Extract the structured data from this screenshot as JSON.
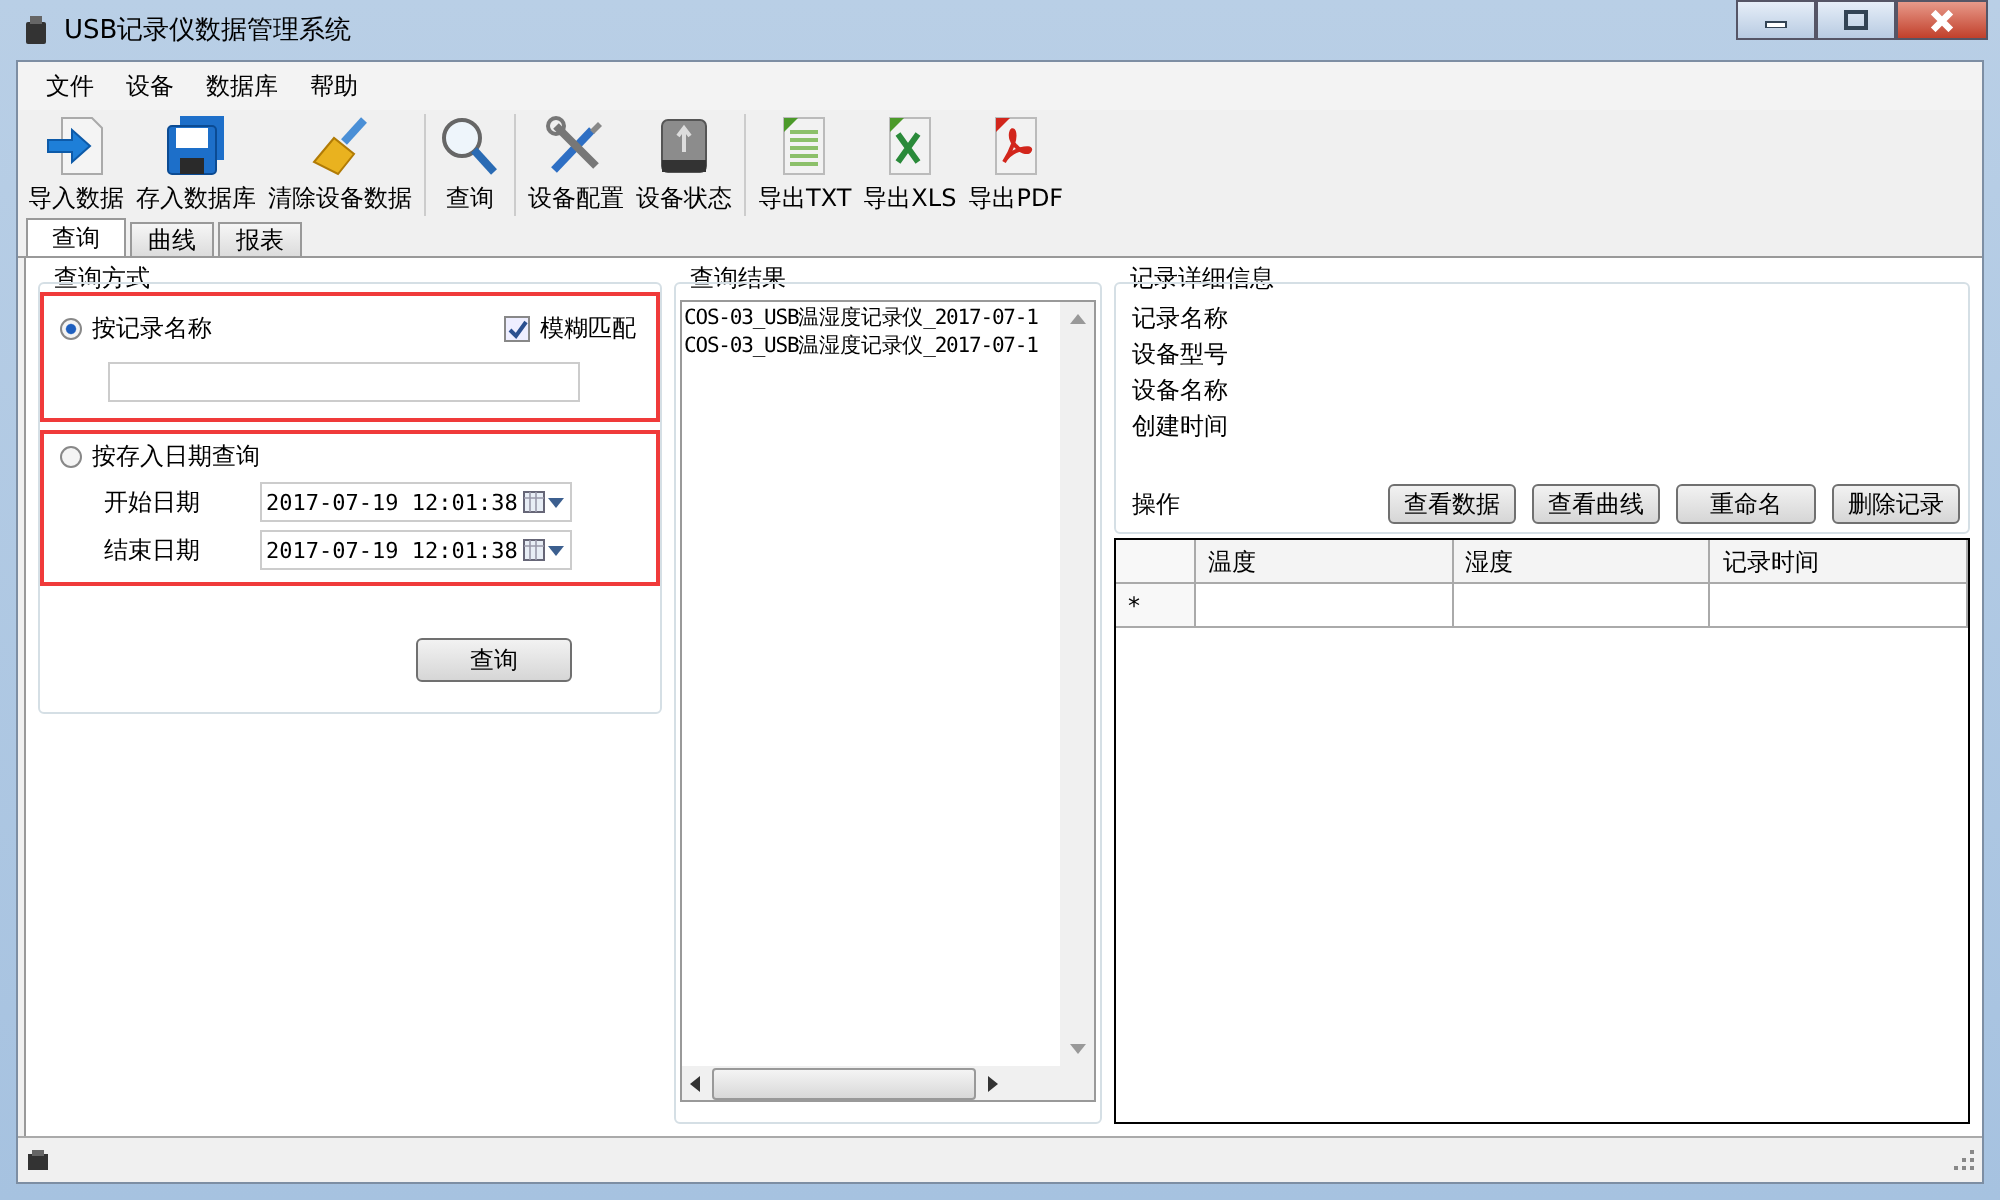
{
  "window": {
    "title": "USB记录仪数据管理系统"
  },
  "menu": [
    "文件",
    "设备",
    "数据库",
    "帮助"
  ],
  "toolbar": [
    {
      "label": "导入数据",
      "kind": "import",
      "separator_before": false
    },
    {
      "label": "存入数据库",
      "kind": "save",
      "separator_before": false
    },
    {
      "label": "清除设备数据",
      "kind": "clear",
      "separator_before": false
    },
    {
      "label": "查询",
      "kind": "search",
      "separator_before": true
    },
    {
      "label": "设备配置",
      "kind": "config",
      "separator_before": true
    },
    {
      "label": "设备状态",
      "kind": "drive",
      "separator_before": false
    },
    {
      "label": "导出TXT",
      "kind": "txt",
      "separator_before": true
    },
    {
      "label": "导出XLS",
      "kind": "xls",
      "separator_before": false
    },
    {
      "label": "导出PDF",
      "kind": "pdf",
      "separator_before": false
    }
  ],
  "tabs": [
    {
      "label": "查询",
      "selected": true
    },
    {
      "label": "曲线",
      "selected": false
    },
    {
      "label": "报表",
      "selected": false
    }
  ],
  "query": {
    "title": "查询方式",
    "by_name": {
      "label": "按记录名称",
      "selected": true,
      "fuzzy": {
        "label": "模糊匹配",
        "checked": true
      }
    },
    "by_date": {
      "label": "按存入日期查询",
      "selected": false,
      "fields": [
        {
          "label": "开始日期",
          "value": "2017-07-19 12:01:38"
        },
        {
          "label": "结束日期",
          "value": "2017-07-19 12:01:38"
        }
      ]
    },
    "button": "查询"
  },
  "results": {
    "title": "查询结果",
    "items": [
      "COS-03_USB温湿度记录仪_2017-07-1",
      "COS-03_USB温湿度记录仪_2017-07-1"
    ]
  },
  "details": {
    "title": "记录详细信息",
    "fields": [
      "记录名称",
      "设备型号",
      "设备名称",
      "创建时间"
    ],
    "operations_label": "操作",
    "buttons": [
      "查看数据",
      "查看曲线",
      "重命名",
      "删除记录"
    ],
    "grid": {
      "columns": [
        "温度",
        "湿度",
        "记录时间"
      ],
      "new_row_marker": "*"
    }
  }
}
